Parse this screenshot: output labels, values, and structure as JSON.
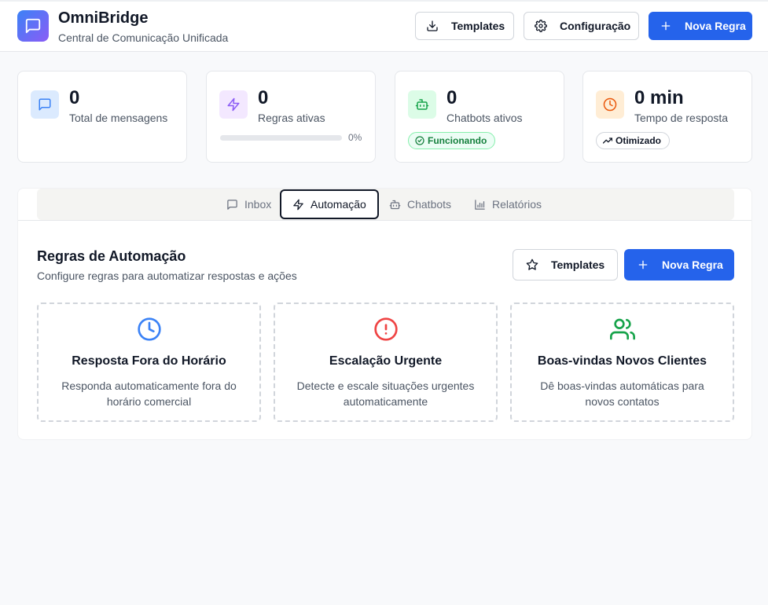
{
  "header": {
    "title": "OmniBridge",
    "subtitle": "Central de Comunicação Unificada",
    "templates_label": "Templates",
    "config_label": "Configuração",
    "new_rule_label": "Nova Regra"
  },
  "stats": [
    {
      "value": "0",
      "label": "Total de mensagens",
      "icon": "message-square-icon",
      "color": "#3b82f6"
    },
    {
      "value": "0",
      "label": "Regras ativas",
      "icon": "zap-icon",
      "color": "#8b5cf6",
      "progress": 0,
      "progress_label": "0%"
    },
    {
      "value": "0",
      "label": "Chatbots ativos",
      "icon": "bot-icon",
      "color": "#16a34a",
      "badge": "Funcionando"
    },
    {
      "value": "0 min",
      "label": "Tempo de resposta",
      "icon": "clock-icon",
      "color": "#ea580c",
      "badge": "Otimizado"
    }
  ],
  "tabs": [
    {
      "label": "Inbox",
      "icon": "message-square-icon"
    },
    {
      "label": "Automação",
      "icon": "zap-icon",
      "active": true
    },
    {
      "label": "Chatbots",
      "icon": "bot-icon"
    },
    {
      "label": "Relatórios",
      "icon": "bar-chart-icon"
    }
  ],
  "automation": {
    "title": "Regras de Automação",
    "subtitle": "Configure regras para automatizar respostas e ações",
    "templates_label": "Templates",
    "new_rule_label": "Nova Regra",
    "templates": [
      {
        "title": "Resposta Fora do Horário",
        "description": "Responda automaticamente fora do horário comercial",
        "icon": "clock-icon",
        "color": "#3b82f6"
      },
      {
        "title": "Escalação Urgente",
        "description": "Detecte e escale situações urgentes automaticamente",
        "icon": "alert-circle-icon",
        "color": "#ef4444"
      },
      {
        "title": "Boas-vindas Novos Clientes",
        "description": "Dê boas-vindas automáticas para novos contatos",
        "icon": "users-icon",
        "color": "#16a34a"
      }
    ]
  }
}
